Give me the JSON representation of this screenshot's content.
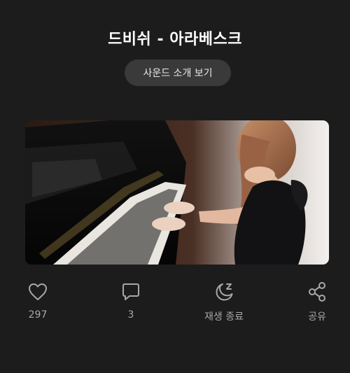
{
  "header": {
    "title": "드비쉬 - 아라베스크",
    "intro_button_label": "사운드 소개 보기"
  },
  "video": {
    "thumbnail": "pianist-playing-upright-piano"
  },
  "actions": [
    {
      "icon": "heart-icon",
      "label": "297"
    },
    {
      "icon": "comment-icon",
      "label": "3"
    },
    {
      "icon": "moon-sleep-icon",
      "label": "재생 종료"
    },
    {
      "icon": "share-icon",
      "label": "공유"
    }
  ],
  "colors": {
    "background": "#1c1c1c",
    "button_bg": "#3a3a3a",
    "icon": "#a8a8a8",
    "text": "#ffffff"
  }
}
